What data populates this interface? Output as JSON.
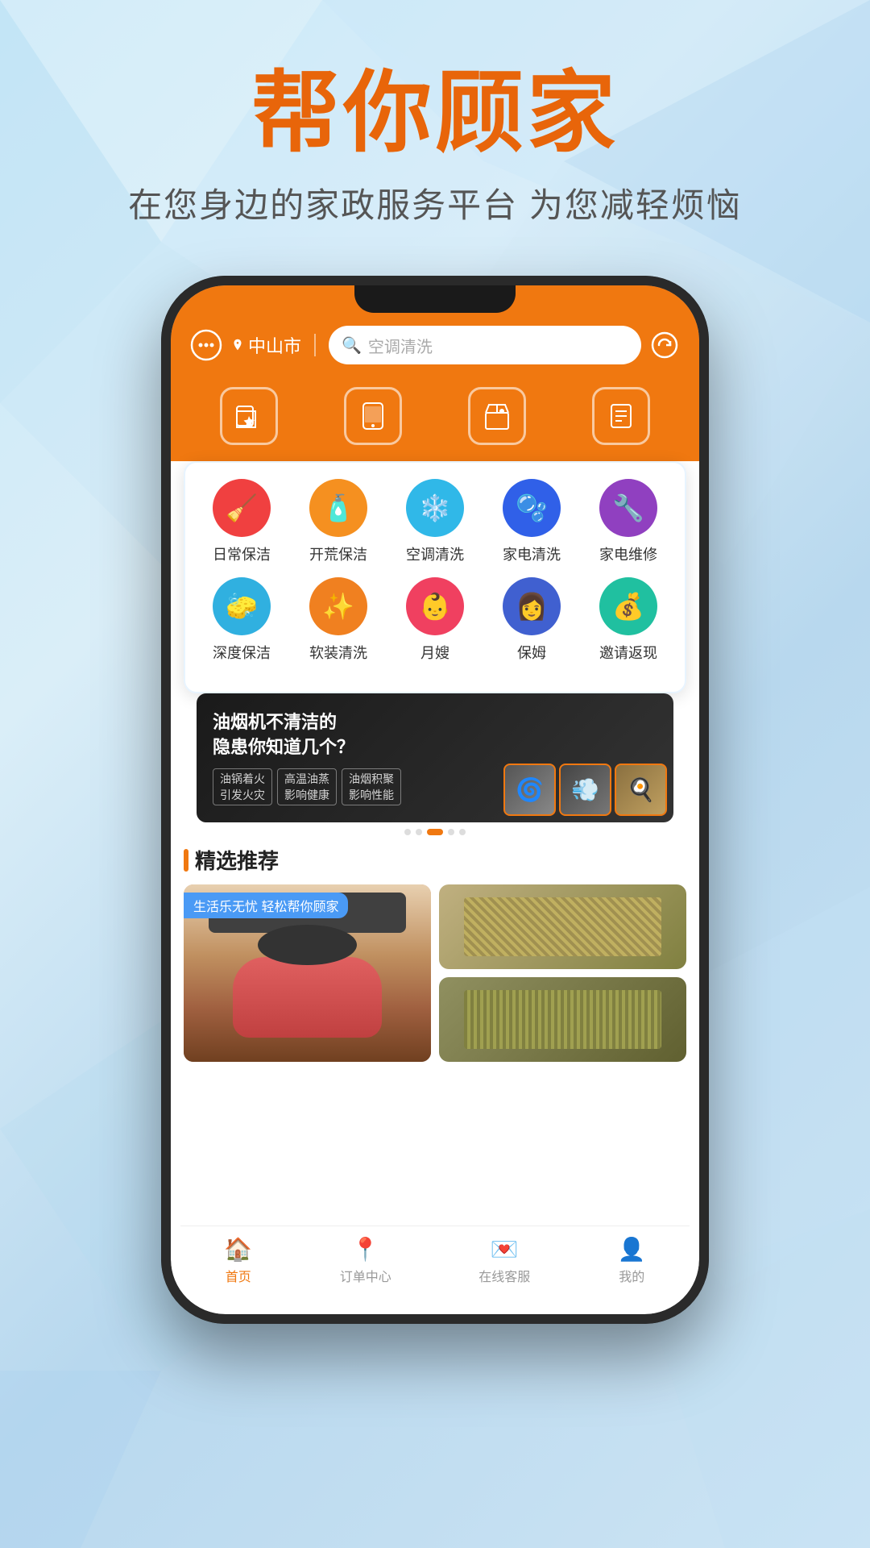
{
  "background": {
    "gradient_start": "#c8e8f8",
    "gradient_end": "#b8d8ee"
  },
  "hero": {
    "title": "帮你顾家",
    "subtitle": "在您身边的家政服务平台 为您减轻烦恼"
  },
  "phone": {
    "header": {
      "location": "中山市",
      "search_placeholder": "空调清洗",
      "chat_icon": "💬",
      "refresh_icon": "↻"
    },
    "nav_icons": [
      {
        "icon": "⭐",
        "label": ""
      },
      {
        "icon": "📱",
        "label": ""
      },
      {
        "icon": "🏪",
        "label": ""
      },
      {
        "icon": "📋",
        "label": ""
      }
    ],
    "services": [
      {
        "icon": "🧹",
        "label": "日常保洁",
        "color": "#f04040"
      },
      {
        "icon": "🧴",
        "label": "开荒保洁",
        "color": "#f59020"
      },
      {
        "icon": "❄️",
        "label": "空调清洗",
        "color": "#30b8e8"
      },
      {
        "icon": "🫧",
        "label": "家电清洗",
        "color": "#3060e8"
      },
      {
        "icon": "🔧",
        "label": "家电维修",
        "color": "#9040c0"
      },
      {
        "icon": "🧽",
        "label": "深度保洁",
        "color": "#30b0e0"
      },
      {
        "icon": "✨",
        "label": "软装清洗",
        "color": "#f08020"
      },
      {
        "icon": "👶",
        "label": "月嫂",
        "color": "#f04060"
      },
      {
        "icon": "👩",
        "label": "保姆",
        "color": "#4060d0"
      },
      {
        "icon": "💰",
        "label": "邀请返现",
        "color": "#20c0a0"
      }
    ],
    "banner": {
      "title": "油烟机不清洁的\n隐患你知道几个？",
      "tags": [
        "油烟着火\n引发火灾",
        "高温油蒸\n影响健康",
        "油烟积聚\n影响性能"
      ],
      "dots": [
        false,
        false,
        true,
        false,
        false
      ]
    },
    "featured": {
      "section_title": "精选推荐",
      "left_label": "生活乐无忧 轻松帮你顾家",
      "items": [
        {
          "color": "#c47050"
        },
        {
          "color": "#8a8060"
        },
        {
          "color": "#7a8050"
        }
      ]
    },
    "bottom_tabs": [
      {
        "icon": "🏠",
        "label": "首页",
        "active": true
      },
      {
        "icon": "📍",
        "label": "订单中心",
        "active": false
      },
      {
        "icon": "💌",
        "label": "在线客服",
        "active": false
      },
      {
        "icon": "👤",
        "label": "我的",
        "active": false
      }
    ]
  }
}
